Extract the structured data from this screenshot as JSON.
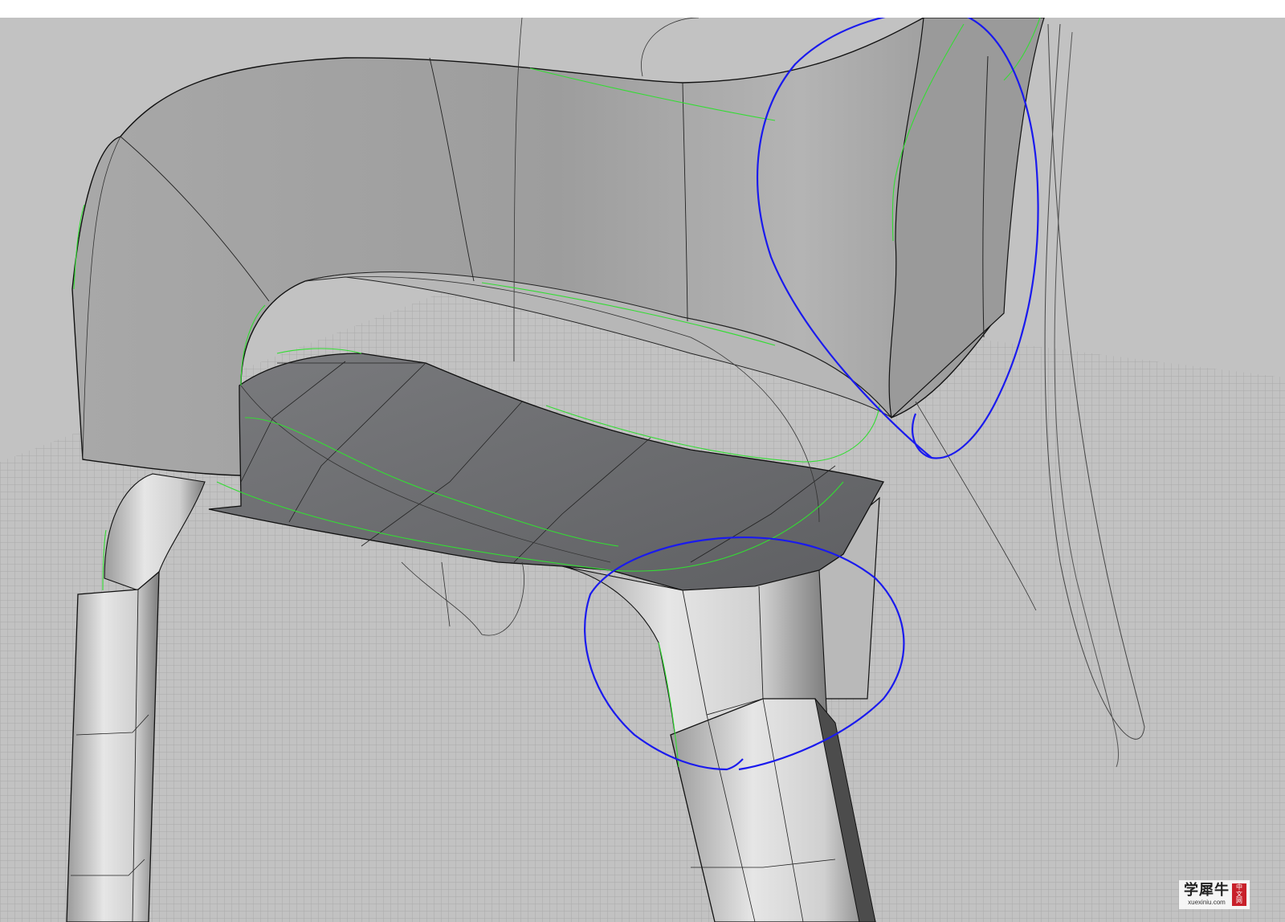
{
  "viewport": {
    "background_color": "#c2c2c2",
    "grid_color": "#aaaaaa",
    "surface_shade_color": "#a4a4a4",
    "seat_color": "#6e6f72",
    "curve_color": "#33dd33",
    "annotation_color": "#1a1aee"
  },
  "watermark": {
    "cn_text": "学犀牛",
    "url": "xuexiniu.com",
    "badge": [
      "中",
      "文",
      "网"
    ]
  }
}
